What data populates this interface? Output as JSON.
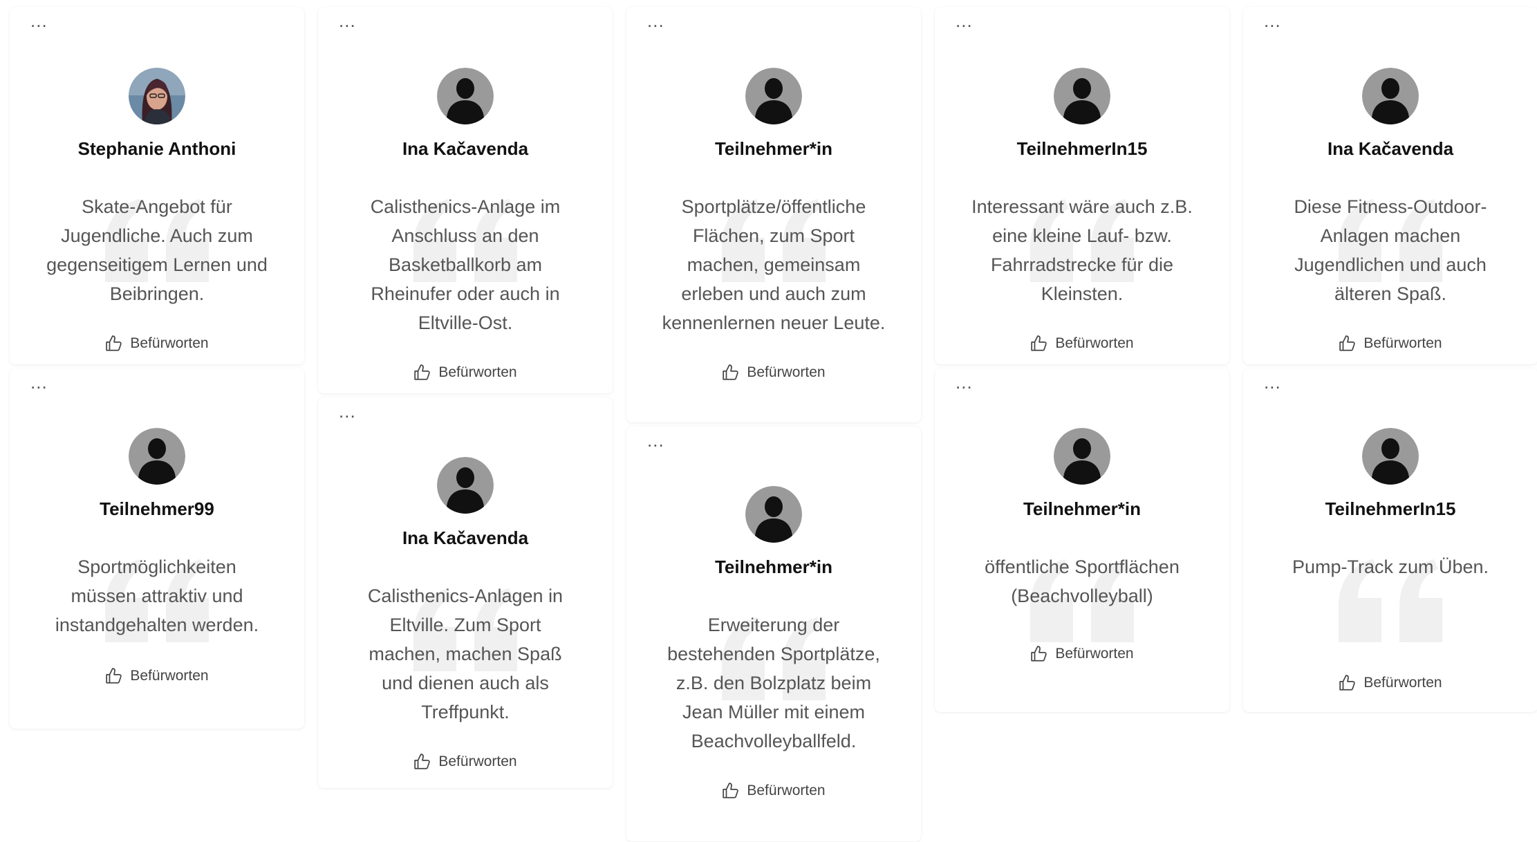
{
  "menu_label": "...",
  "like_label": "Befürworten",
  "colors": {
    "avatar_bg": "#9a9a9a",
    "silhouette": "#111111",
    "quote_mark": "#f0f0f0"
  },
  "columns": [
    {
      "cards": [
        {
          "name": "Stephanie Anthoni",
          "avatar": "photo",
          "text": "Skate-Angebot für Jugendliche. Auch zum gegenseitigem Lernen und Beibringen."
        },
        {
          "name": "Teilnehmer99",
          "avatar": "default",
          "text": "Sportmöglichkeiten müssen attraktiv und instandgehalten werden."
        }
      ]
    },
    {
      "cards": [
        {
          "name": "Ina Kačavenda",
          "avatar": "default",
          "text": "Calisthenics-Anlage im Anschluss an den Basketballkorb am Rheinufer oder auch in Eltville-Ost."
        },
        {
          "name": "Ina Kačavenda",
          "avatar": "default",
          "text": "Calisthenics-Anlagen in Eltville. Zum Sport machen, machen Spaß und dienen auch als Treffpunkt."
        }
      ]
    },
    {
      "cards": [
        {
          "name": "Teilnehmer*in",
          "avatar": "default",
          "text": "Sportplätze/öffentliche Flächen, zum Sport machen, gemeinsam erleben und auch zum kennenlernen neuer Leute."
        },
        {
          "name": "Teilnehmer*in",
          "avatar": "default",
          "text": "Erweiterung der bestehenden Sportplätze, z.B. den Bolzplatz beim Jean Müller mit einem Beachvolleyballfeld."
        }
      ]
    },
    {
      "cards": [
        {
          "name": "TeilnehmerIn15",
          "avatar": "default",
          "text": "Interessant wäre auch z.B. eine kleine Lauf- bzw. Fahrradstrecke für die Kleinsten."
        },
        {
          "name": "Teilnehmer*in",
          "avatar": "default",
          "text": "öffentliche Sportflächen (Beachvolleyball)"
        }
      ]
    },
    {
      "cards": [
        {
          "name": "Ina Kačavenda",
          "avatar": "default",
          "text": "Diese Fitness-Outdoor-Anlagen machen Jugendlichen und auch älteren Spaß."
        },
        {
          "name": "TeilnehmerIn15",
          "avatar": "default",
          "text": "Pump-Track zum Üben."
        }
      ]
    }
  ]
}
